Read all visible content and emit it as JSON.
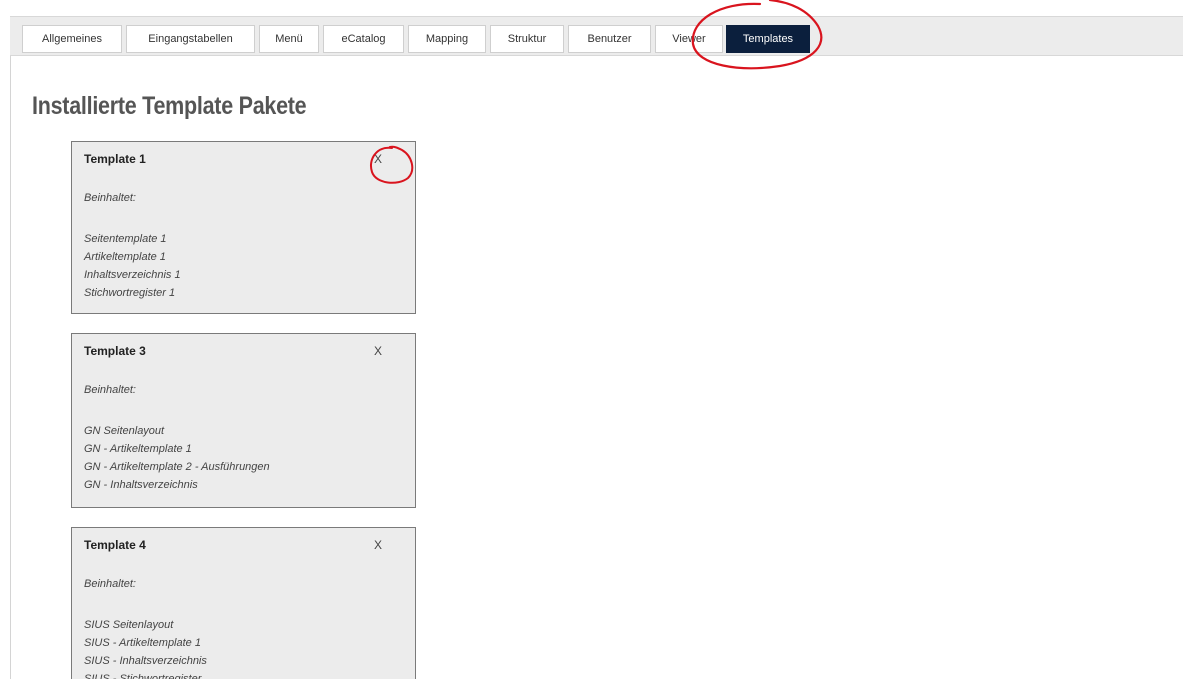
{
  "tabs": [
    {
      "label": "Allgemeines",
      "active": false
    },
    {
      "label": "Eingangstabellen",
      "active": false
    },
    {
      "label": "Menü",
      "active": false
    },
    {
      "label": "eCatalog",
      "active": false
    },
    {
      "label": "Mapping",
      "active": false
    },
    {
      "label": "Struktur",
      "active": false
    },
    {
      "label": "Benutzer",
      "active": false
    },
    {
      "label": "Viewer",
      "active": false
    },
    {
      "label": "Templates",
      "active": true
    }
  ],
  "page_title": "Installierte Template Pakete",
  "packages": [
    {
      "title": "Template 1",
      "close_label": "X",
      "contains_label": "Beinhaltet:",
      "items": [
        "Seitentemplate 1",
        "Artikeltemplate 1",
        "Inhaltsverzeichnis 1",
        "Stichwortregister 1"
      ]
    },
    {
      "title": "Template 3",
      "close_label": "X",
      "contains_label": "Beinhaltet:",
      "items": [
        "GN Seitenlayout",
        "GN - Artikeltemplate 1",
        "GN - Artikeltemplate 2 - Ausführungen",
        "GN - Inhaltsverzeichnis"
      ]
    },
    {
      "title": "Template 4",
      "close_label": "X",
      "contains_label": "Beinhaltet:",
      "items": [
        "SIUS Seitenlayout",
        "SIUS - Artikeltemplate 1",
        "SIUS - Inhaltsverzeichnis",
        "SIUS - Stichwortregister"
      ]
    }
  ],
  "colors": {
    "active_tab_bg": "#0b1f3d",
    "annotation": "#d9141e",
    "card_bg": "#ececec"
  }
}
